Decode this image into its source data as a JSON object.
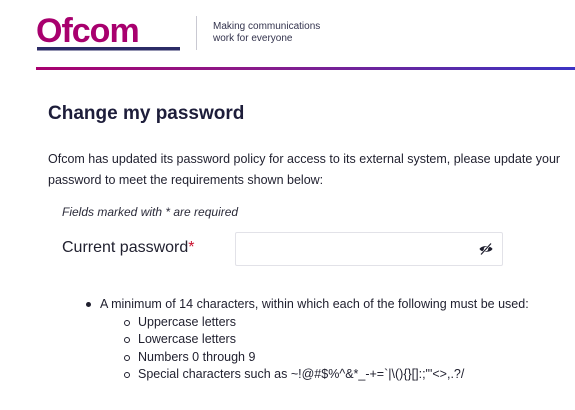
{
  "header": {
    "logo_text": "Ofcom",
    "tagline_line1": "Making communications",
    "tagline_line2": "work for everyone",
    "colors": {
      "brand_magenta": "#a8006e",
      "brand_navy": "#2b2b66",
      "gradient_end": "#3b33c4"
    }
  },
  "page": {
    "title": "Change my password",
    "intro": "Ofcom has updated its password policy for access to its external system, please update your password to meet the requirements shown below:",
    "required_note": "Fields marked with * are required"
  },
  "form": {
    "current_password": {
      "label": "Current password",
      "required_marker": "*",
      "value": "",
      "placeholder": "",
      "toggle_icon": "eye-slash-icon"
    }
  },
  "requirements": {
    "main": "A minimum of 14 characters, within which each of the following must be used:",
    "items": [
      "Uppercase letters",
      "Lowercase letters",
      "Numbers 0 through 9",
      "Special characters such as ~!@#$%^&*_-+=`|\\(){}[]:;\"'<>,.?/"
    ]
  }
}
